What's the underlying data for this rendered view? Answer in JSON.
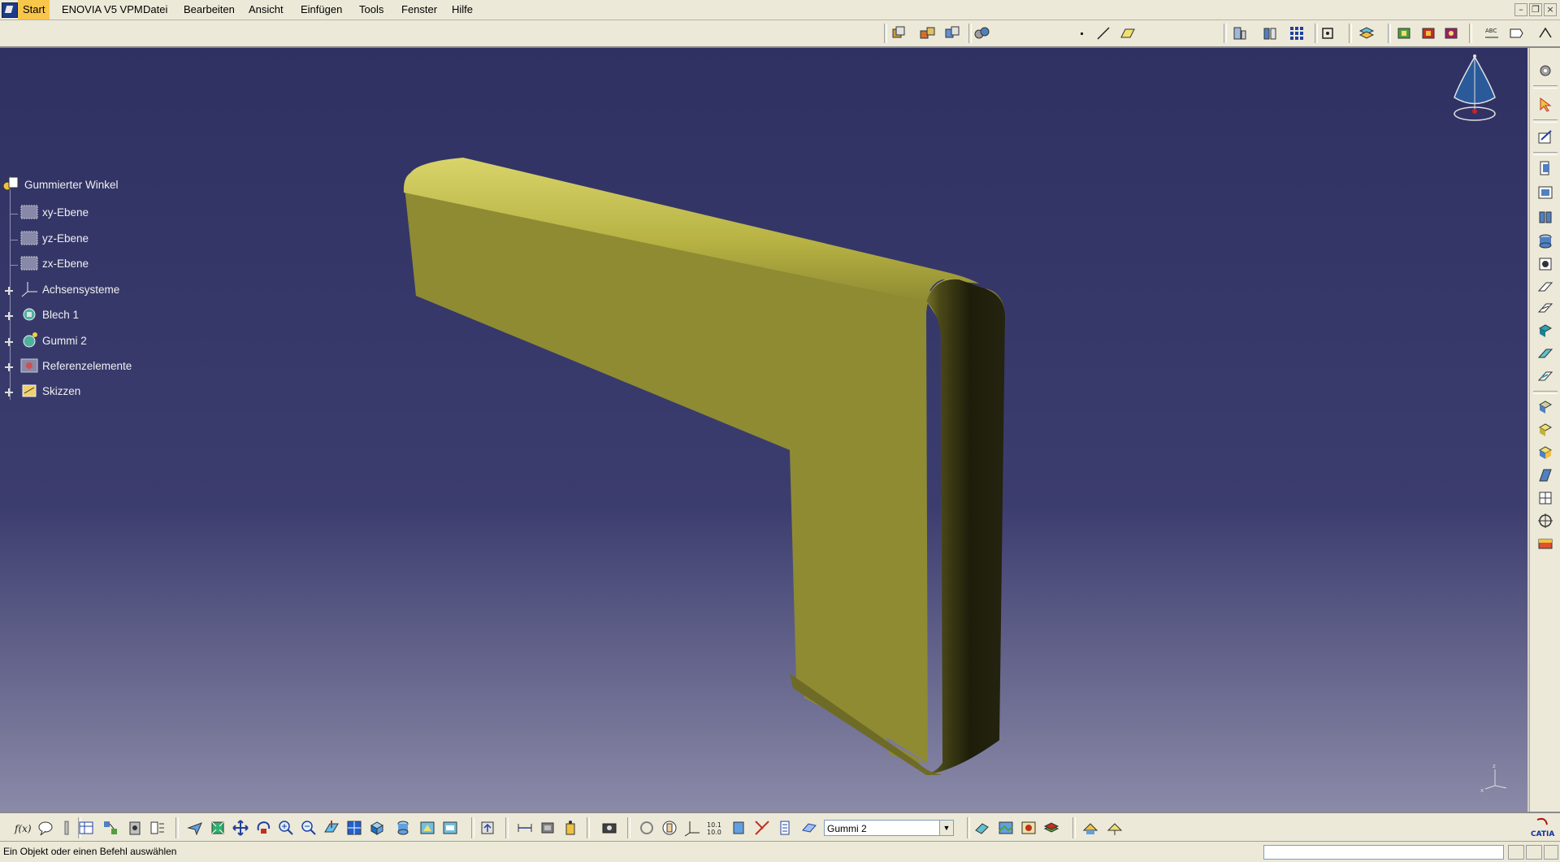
{
  "menubar": {
    "items": [
      {
        "label": "Start",
        "active": true
      },
      {
        "label": "ENOVIA V5 VPM"
      },
      {
        "label": "Datei"
      },
      {
        "label": "Bearbeiten"
      },
      {
        "label": "Ansicht"
      },
      {
        "label": "Einfügen"
      },
      {
        "label": "Tools"
      },
      {
        "label": "Fenster"
      },
      {
        "label": "Hilfe"
      }
    ]
  },
  "tree": {
    "root": "Gummierter Winkel",
    "nodes": [
      {
        "label": "xy-Ebene",
        "icon": "plane-icon",
        "expandable": false
      },
      {
        "label": "yz-Ebene",
        "icon": "plane-icon",
        "expandable": false
      },
      {
        "label": "zx-Ebene",
        "icon": "plane-icon",
        "expandable": false
      },
      {
        "label": "Achsensysteme",
        "icon": "axis-system-icon",
        "expandable": true
      },
      {
        "label": "Blech 1",
        "icon": "sheet-metal-icon",
        "expandable": true
      },
      {
        "label": "Gummi 2",
        "icon": "rubber-body-icon",
        "expandable": true
      },
      {
        "label": "Referenzelemente",
        "icon": "reference-elements-icon",
        "expandable": true
      },
      {
        "label": "Skizzen",
        "icon": "sketch-icon",
        "expandable": true
      }
    ]
  },
  "bottom": {
    "current_body": "Gummi 2"
  },
  "status": {
    "message": "Ein Objekt oder einen Befehl auswählen"
  },
  "logo": {
    "text": "CATIA"
  },
  "colors": {
    "part_face": "#8e8b33",
    "part_highlight": "#c6c24a",
    "part_shadow": "#1d1d0a",
    "background_top": "#2f3163",
    "background_bottom": "#8b8aa8",
    "menubar_active": "#f7c64a"
  }
}
